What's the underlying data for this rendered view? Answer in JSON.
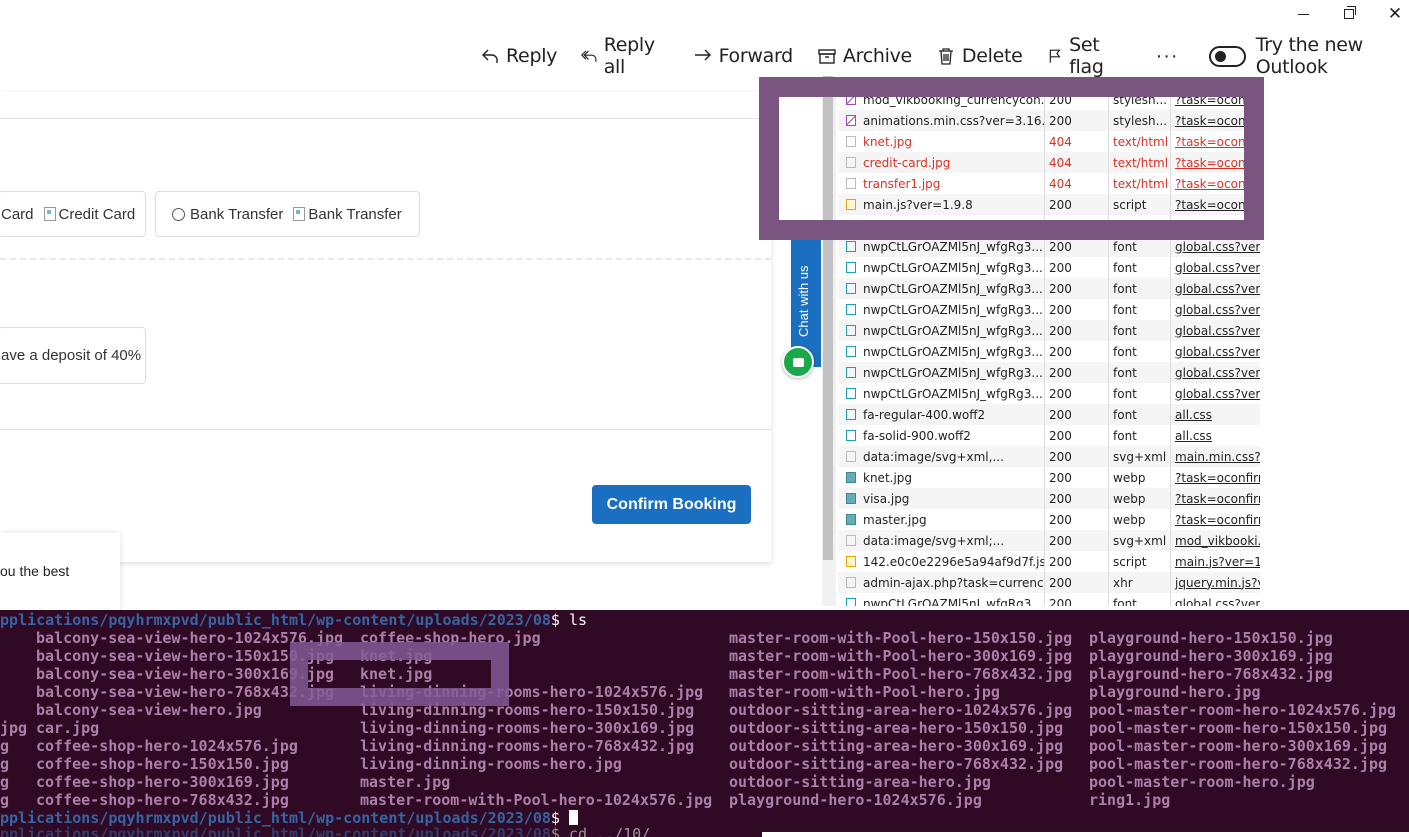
{
  "window": {
    "minimize_glyph": "",
    "close_glyph": "✕"
  },
  "toolbar": {
    "reply": "Reply",
    "reply_all": "Reply all",
    "forward": "Forward",
    "archive": "Archive",
    "delete": "Delete",
    "set_flag": "Set flag",
    "more": "···",
    "try_outlook": "Try the new Outlook"
  },
  "booking": {
    "credit_card_partial": "Card",
    "credit_card_alt": "Credit Card",
    "bank_transfer": "Bank Transfer",
    "bank_transfer_alt": "Bank Transfer",
    "deposit_partial": "ave a deposit of 40%",
    "confirm_button": "Confirm Booking",
    "float_text": "ou the best"
  },
  "chat": {
    "label": "Chat with us"
  },
  "network": {
    "rows": [
      {
        "name": "mod_vikbooking_currencycon...",
        "status": "200",
        "type": "stylesh...",
        "initiator": "?task=oconfirm",
        "icon": "css"
      },
      {
        "name": "animations.min.css?ver=3.16.5",
        "status": "200",
        "type": "stylesh...",
        "initiator": "?task=oconfirm",
        "icon": "css"
      },
      {
        "name": "knet.jpg",
        "status": "404",
        "type": "text/html",
        "initiator": "?task=oconfirm",
        "icon": "doc",
        "error": true
      },
      {
        "name": "credit-card.jpg",
        "status": "404",
        "type": "text/html",
        "initiator": "?task=oconfirm",
        "icon": "doc",
        "error": true
      },
      {
        "name": "transfer1.jpg",
        "status": "404",
        "type": "text/html",
        "initiator": "?task=oconfirm",
        "icon": "doc",
        "error": true
      },
      {
        "name": "main.js?ver=1.9.8",
        "status": "200",
        "type": "script",
        "initiator": "?task=oconfirm",
        "icon": "js"
      },
      {
        "name": "",
        "status": "",
        "type": "",
        "initiator": "",
        "icon": "font"
      },
      {
        "name": "nwpCtLGrOAZMl5nJ_wfgRg3...",
        "status": "200",
        "type": "font",
        "initiator": "global.css?ver=...",
        "icon": "font"
      },
      {
        "name": "nwpCtLGrOAZMl5nJ_wfgRg3...",
        "status": "200",
        "type": "font",
        "initiator": "global.css?ver=...",
        "icon": "font"
      },
      {
        "name": "nwpCtLGrOAZMl5nJ_wfgRg3...",
        "status": "200",
        "type": "font",
        "initiator": "global.css?ver=...",
        "icon": "font"
      },
      {
        "name": "nwpCtLGrOAZMl5nJ_wfgRg3...",
        "status": "200",
        "type": "font",
        "initiator": "global.css?ver=...",
        "icon": "font"
      },
      {
        "name": "nwpCtLGrOAZMl5nJ_wfgRg3...",
        "status": "200",
        "type": "font",
        "initiator": "global.css?ver=...",
        "icon": "font"
      },
      {
        "name": "nwpCtLGrOAZMl5nJ_wfgRg3...",
        "status": "200",
        "type": "font",
        "initiator": "global.css?ver=...",
        "icon": "font"
      },
      {
        "name": "nwpCtLGrOAZMl5nJ_wfgRg3...",
        "status": "200",
        "type": "font",
        "initiator": "global.css?ver=...",
        "icon": "font"
      },
      {
        "name": "nwpCtLGrOAZMl5nJ_wfgRg3...",
        "status": "200",
        "type": "font",
        "initiator": "global.css?ver=...",
        "icon": "font"
      },
      {
        "name": "fa-regular-400.woff2",
        "status": "200",
        "type": "font",
        "initiator": "all.css",
        "icon": "font"
      },
      {
        "name": "fa-solid-900.woff2",
        "status": "200",
        "type": "font",
        "initiator": "all.css",
        "icon": "font"
      },
      {
        "name": "data:image/svg+xml,...",
        "status": "200",
        "type": "svg+xml",
        "initiator": "main.min.css?v...",
        "icon": "doc"
      },
      {
        "name": "knet.jpg",
        "status": "200",
        "type": "webp",
        "initiator": "?task=oconfirm",
        "icon": "img"
      },
      {
        "name": "visa.jpg",
        "status": "200",
        "type": "webp",
        "initiator": "?task=oconfirm",
        "icon": "img"
      },
      {
        "name": "master.jpg",
        "status": "200",
        "type": "webp",
        "initiator": "?task=oconfirm",
        "icon": "img"
      },
      {
        "name": "data:image/svg+xml;...",
        "status": "200",
        "type": "svg+xml",
        "initiator": "mod_vikbooki...",
        "icon": "doc"
      },
      {
        "name": "142.e0c0e2296e5a94af9d7f.js",
        "status": "200",
        "type": "script",
        "initiator": "main.js?ver=1...",
        "icon": "js"
      },
      {
        "name": "admin-ajax.php?task=currency...",
        "status": "200",
        "type": "xhr",
        "initiator": "jquery.min.js?v...",
        "icon": "doc"
      },
      {
        "name": "nwpCtLGrOAZMl5nJ_wfgRg3...",
        "status": "200",
        "type": "font",
        "initiator": "global.css?ver=...",
        "icon": "font"
      }
    ]
  },
  "terminal": {
    "prompt_path": "pplications/pqyhrmxpvd/public_html/wp-content/uploads/2023/08",
    "command_ls": "$ ls",
    "columns": [
      [
        "balcony-sea-view-hero-1024x576.jpg",
        "balcony-sea-view-hero-150x150.jpg",
        "balcony-sea-view-hero-300x169.jpg",
        "balcony-sea-view-hero-768x432.jpg",
        "balcony-sea-view-hero.jpg",
        "car.jpg",
        "coffee-shop-hero-1024x576.jpg",
        "coffee-shop-hero-150x150.jpg",
        "coffee-shop-hero-300x169.jpg",
        "coffee-shop-hero-768x432.jpg"
      ],
      [
        "coffee-shop-hero.jpg",
        "knet.jpg",
        "knet.jpg",
        "living-dinning-rooms-hero-1024x576.jpg",
        "living-dinning-rooms-hero-150x150.jpg",
        "living-dinning-rooms-hero-300x169.jpg",
        "living-dinning-rooms-hero-768x432.jpg",
        "living-dinning-rooms-hero.jpg",
        "master.jpg",
        "master-room-with-Pool-hero-1024x576.jpg"
      ],
      [
        "master-room-with-Pool-hero-150x150.jpg",
        "master-room-with-Pool-hero-300x169.jpg",
        "master-room-with-Pool-hero-768x432.jpg",
        "master-room-with-Pool-hero.jpg",
        "outdoor-sitting-area-hero-1024x576.jpg",
        "outdoor-sitting-area-hero-150x150.jpg",
        "outdoor-sitting-area-hero-300x169.jpg",
        "outdoor-sitting-area-hero-768x432.jpg",
        "outdoor-sitting-area-hero.jpg",
        "playground-hero-1024x576.jpg"
      ],
      [
        "playground-hero-150x150.jpg",
        "playground-hero-300x169.jpg",
        "playground-hero-768x432.jpg",
        "playground-hero.jpg",
        "pool-master-room-hero-1024x576.jpg",
        "pool-master-room-hero-150x150.jpg",
        "pool-master-room-hero-300x169.jpg",
        "pool-master-room-hero-768x432.jpg",
        "pool-master-room-hero.jpg",
        "ring1.jpg"
      ]
    ],
    "left_fragments": [
      "jpg",
      "g",
      "g",
      "g",
      "g"
    ],
    "prompt_end": "$ ",
    "last_line_partial": "$ cd ../10/"
  }
}
